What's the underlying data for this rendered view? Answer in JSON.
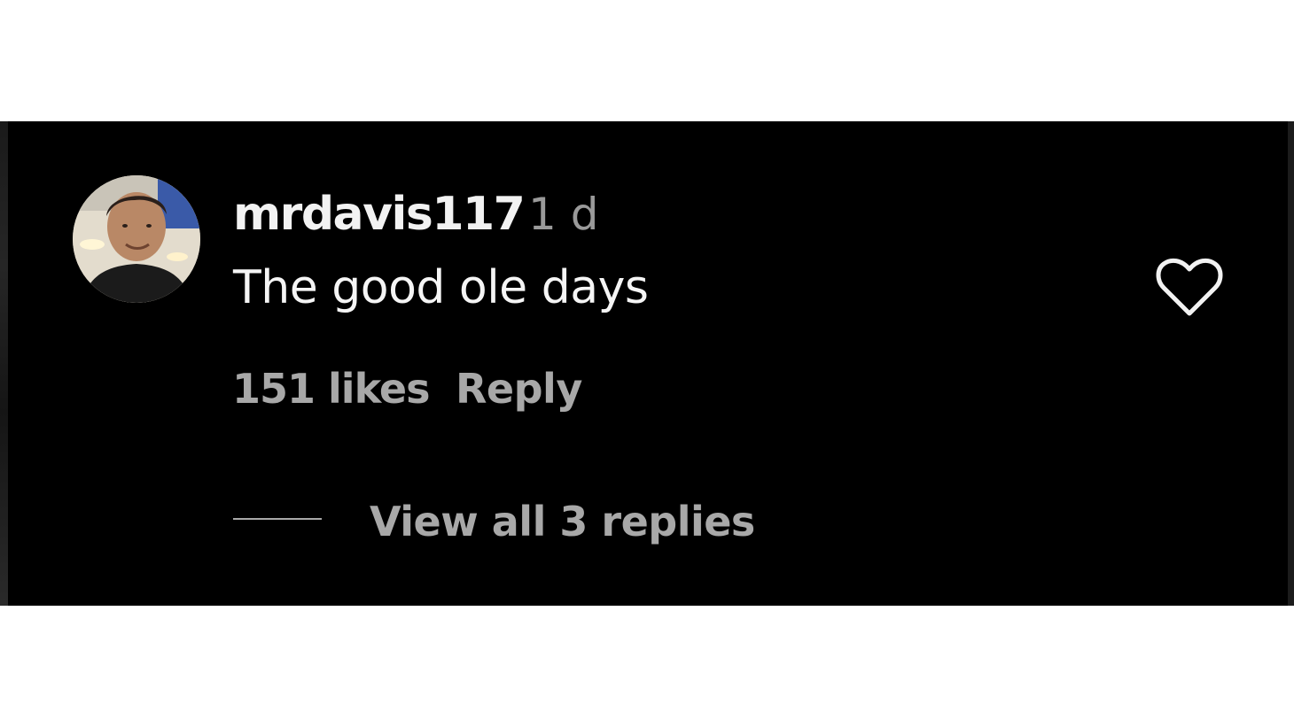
{
  "comment": {
    "username": "mrdavis117",
    "time_ago": "1 d",
    "text": "The good ole days",
    "likes_label": "151 likes",
    "reply_label": "Reply",
    "view_replies_label": "View all 3 replies",
    "liked": false
  },
  "icons": {
    "like": "heart-outline-icon",
    "avatar": "profile-photo"
  },
  "colors": {
    "panel_background": "#000000",
    "primary_text": "#f5f5f5",
    "secondary_text": "#a8a8a8"
  }
}
